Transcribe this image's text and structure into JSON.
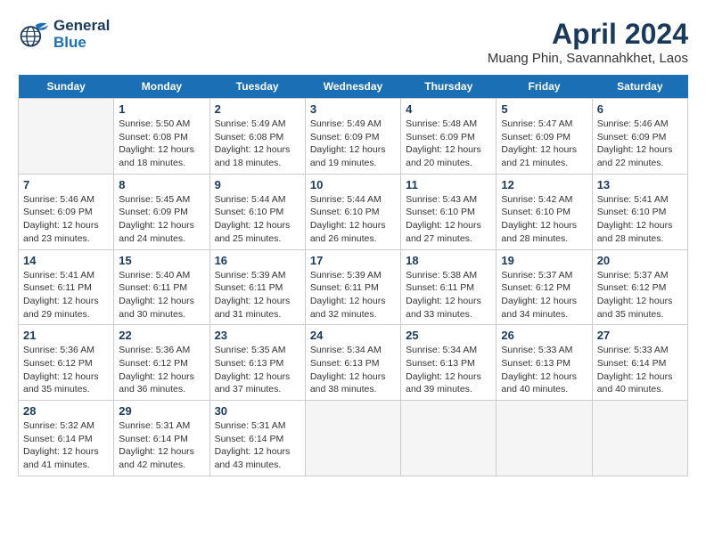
{
  "header": {
    "logo_line1": "General",
    "logo_line2": "Blue",
    "title": "April 2024",
    "subtitle": "Muang Phin, Savannahkhet, Laos"
  },
  "days_of_week": [
    "Sunday",
    "Monday",
    "Tuesday",
    "Wednesday",
    "Thursday",
    "Friday",
    "Saturday"
  ],
  "weeks": [
    [
      {
        "num": "",
        "info": "",
        "empty": true
      },
      {
        "num": "1",
        "info": "Sunrise: 5:50 AM\nSunset: 6:08 PM\nDaylight: 12 hours\nand 18 minutes."
      },
      {
        "num": "2",
        "info": "Sunrise: 5:49 AM\nSunset: 6:08 PM\nDaylight: 12 hours\nand 18 minutes."
      },
      {
        "num": "3",
        "info": "Sunrise: 5:49 AM\nSunset: 6:09 PM\nDaylight: 12 hours\nand 19 minutes."
      },
      {
        "num": "4",
        "info": "Sunrise: 5:48 AM\nSunset: 6:09 PM\nDaylight: 12 hours\nand 20 minutes."
      },
      {
        "num": "5",
        "info": "Sunrise: 5:47 AM\nSunset: 6:09 PM\nDaylight: 12 hours\nand 21 minutes."
      },
      {
        "num": "6",
        "info": "Sunrise: 5:46 AM\nSunset: 6:09 PM\nDaylight: 12 hours\nand 22 minutes."
      }
    ],
    [
      {
        "num": "7",
        "info": "Sunrise: 5:46 AM\nSunset: 6:09 PM\nDaylight: 12 hours\nand 23 minutes."
      },
      {
        "num": "8",
        "info": "Sunrise: 5:45 AM\nSunset: 6:09 PM\nDaylight: 12 hours\nand 24 minutes."
      },
      {
        "num": "9",
        "info": "Sunrise: 5:44 AM\nSunset: 6:10 PM\nDaylight: 12 hours\nand 25 minutes."
      },
      {
        "num": "10",
        "info": "Sunrise: 5:44 AM\nSunset: 6:10 PM\nDaylight: 12 hours\nand 26 minutes."
      },
      {
        "num": "11",
        "info": "Sunrise: 5:43 AM\nSunset: 6:10 PM\nDaylight: 12 hours\nand 27 minutes."
      },
      {
        "num": "12",
        "info": "Sunrise: 5:42 AM\nSunset: 6:10 PM\nDaylight: 12 hours\nand 28 minutes."
      },
      {
        "num": "13",
        "info": "Sunrise: 5:41 AM\nSunset: 6:10 PM\nDaylight: 12 hours\nand 28 minutes."
      }
    ],
    [
      {
        "num": "14",
        "info": "Sunrise: 5:41 AM\nSunset: 6:11 PM\nDaylight: 12 hours\nand 29 minutes."
      },
      {
        "num": "15",
        "info": "Sunrise: 5:40 AM\nSunset: 6:11 PM\nDaylight: 12 hours\nand 30 minutes."
      },
      {
        "num": "16",
        "info": "Sunrise: 5:39 AM\nSunset: 6:11 PM\nDaylight: 12 hours\nand 31 minutes."
      },
      {
        "num": "17",
        "info": "Sunrise: 5:39 AM\nSunset: 6:11 PM\nDaylight: 12 hours\nand 32 minutes."
      },
      {
        "num": "18",
        "info": "Sunrise: 5:38 AM\nSunset: 6:11 PM\nDaylight: 12 hours\nand 33 minutes."
      },
      {
        "num": "19",
        "info": "Sunrise: 5:37 AM\nSunset: 6:12 PM\nDaylight: 12 hours\nand 34 minutes."
      },
      {
        "num": "20",
        "info": "Sunrise: 5:37 AM\nSunset: 6:12 PM\nDaylight: 12 hours\nand 35 minutes."
      }
    ],
    [
      {
        "num": "21",
        "info": "Sunrise: 5:36 AM\nSunset: 6:12 PM\nDaylight: 12 hours\nand 35 minutes."
      },
      {
        "num": "22",
        "info": "Sunrise: 5:36 AM\nSunset: 6:12 PM\nDaylight: 12 hours\nand 36 minutes."
      },
      {
        "num": "23",
        "info": "Sunrise: 5:35 AM\nSunset: 6:13 PM\nDaylight: 12 hours\nand 37 minutes."
      },
      {
        "num": "24",
        "info": "Sunrise: 5:34 AM\nSunset: 6:13 PM\nDaylight: 12 hours\nand 38 minutes."
      },
      {
        "num": "25",
        "info": "Sunrise: 5:34 AM\nSunset: 6:13 PM\nDaylight: 12 hours\nand 39 minutes."
      },
      {
        "num": "26",
        "info": "Sunrise: 5:33 AM\nSunset: 6:13 PM\nDaylight: 12 hours\nand 40 minutes."
      },
      {
        "num": "27",
        "info": "Sunrise: 5:33 AM\nSunset: 6:14 PM\nDaylight: 12 hours\nand 40 minutes."
      }
    ],
    [
      {
        "num": "28",
        "info": "Sunrise: 5:32 AM\nSunset: 6:14 PM\nDaylight: 12 hours\nand 41 minutes."
      },
      {
        "num": "29",
        "info": "Sunrise: 5:31 AM\nSunset: 6:14 PM\nDaylight: 12 hours\nand 42 minutes."
      },
      {
        "num": "30",
        "info": "Sunrise: 5:31 AM\nSunset: 6:14 PM\nDaylight: 12 hours\nand 43 minutes."
      },
      {
        "num": "",
        "info": "",
        "empty": true
      },
      {
        "num": "",
        "info": "",
        "empty": true
      },
      {
        "num": "",
        "info": "",
        "empty": true
      },
      {
        "num": "",
        "info": "",
        "empty": true
      }
    ]
  ]
}
